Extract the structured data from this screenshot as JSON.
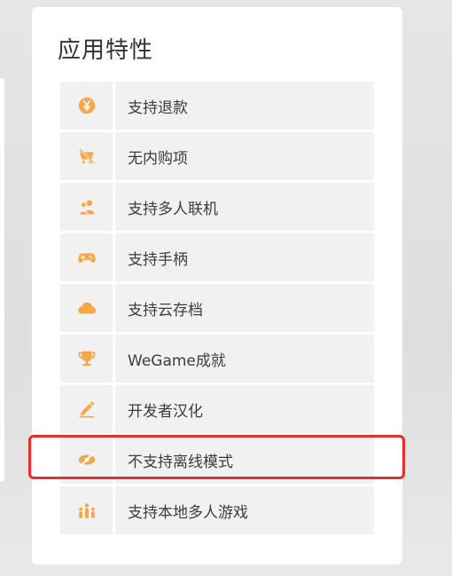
{
  "card": {
    "title": "应用特性"
  },
  "features": [
    {
      "label": "支持退款",
      "icon": "yuan-coin-icon"
    },
    {
      "label": "无内购项",
      "icon": "no-purchase-icon"
    },
    {
      "label": "支持多人联机",
      "icon": "multiplayer-icon"
    },
    {
      "label": "支持手柄",
      "icon": "gamepad-icon"
    },
    {
      "label": "支持云存档",
      "icon": "cloud-icon"
    },
    {
      "label": "WeGame成就",
      "icon": "trophy-icon"
    },
    {
      "label": "开发者汉化",
      "icon": "pen-icon"
    },
    {
      "label": "不支持离线模式",
      "icon": "offline-disabled-icon"
    },
    {
      "label": "支持本地多人游戏",
      "icon": "local-multiplayer-icon"
    }
  ],
  "colors": {
    "icon_accent": "#f7a64a",
    "highlight_border": "#e4302b",
    "row_background": "#f1f1f1"
  }
}
